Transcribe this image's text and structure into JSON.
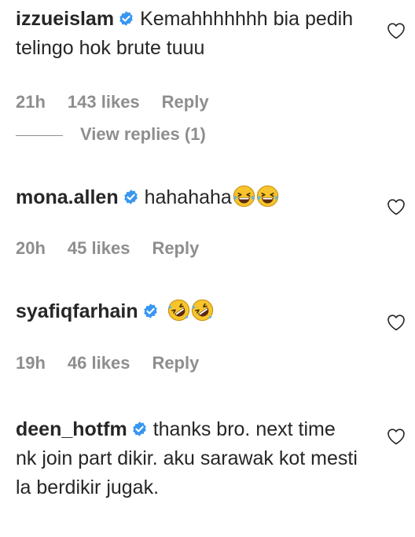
{
  "comments": [
    {
      "username": "izzueislam",
      "text": "Kemahhhhhhh bia pedih telingo hok brute tuuu",
      "time": "21h",
      "likes": "143 likes",
      "reply": "Reply",
      "view_replies": "View replies (1)"
    },
    {
      "username": "mona.allen",
      "text": "hahahaha",
      "emojis": [
        "grinning-squinting-tears-emoji",
        "grinning-squinting-tears-emoji"
      ],
      "time": "20h",
      "likes": "45 likes",
      "reply": "Reply"
    },
    {
      "username": "syafiqfarhain",
      "text": "",
      "emojis": [
        "rolling-on-floor-laughing-emoji",
        "rolling-on-floor-laughing-emoji"
      ],
      "time": "19h",
      "likes": "46 likes",
      "reply": "Reply"
    },
    {
      "username": "deen_hotfm",
      "text": "thanks bro. next time nk join part dikir. aku sarawak kot mesti la berdikir jugak."
    }
  ],
  "icons": {
    "verified": "verified-badge-icon",
    "like": "heart-outline-icon"
  },
  "colors": {
    "verified": "#3897f0",
    "meta": "#8e8e8e",
    "text": "#262626",
    "emoji": "#f7c52b"
  }
}
